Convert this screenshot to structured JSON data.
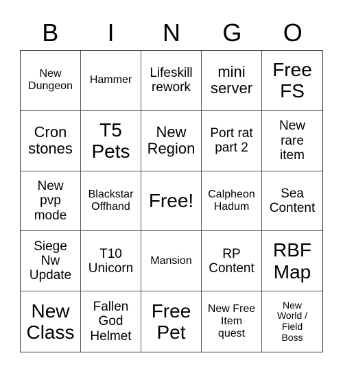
{
  "header": {
    "letters": [
      "B",
      "I",
      "N",
      "G",
      "O"
    ]
  },
  "board": {
    "cells": [
      {
        "text": "New\nDungeon",
        "size": "fs-s"
      },
      {
        "text": "Hammer",
        "size": "fs-s"
      },
      {
        "text": "Lifeskill\nrework",
        "size": "fs-m"
      },
      {
        "text": "mini\nserver",
        "size": "fs-l"
      },
      {
        "text": "Free\nFS",
        "size": "fs-xl"
      },
      {
        "text": "Cron\nstones",
        "size": "fs-l"
      },
      {
        "text": "T5\nPets",
        "size": "fs-xl"
      },
      {
        "text": "New\nRegion",
        "size": "fs-l"
      },
      {
        "text": "Port rat\npart 2",
        "size": "fs-m"
      },
      {
        "text": "New\nrare\nitem",
        "size": "fs-m"
      },
      {
        "text": "New\npvp\nmode",
        "size": "fs-m"
      },
      {
        "text": "Blackstar\nOffhand",
        "size": "fs-s"
      },
      {
        "text": "Free!",
        "size": "fs-xl"
      },
      {
        "text": "Calpheon\nHadum",
        "size": "fs-s"
      },
      {
        "text": "Sea\nContent",
        "size": "fs-m"
      },
      {
        "text": "Siege\nNw\nUpdate",
        "size": "fs-m"
      },
      {
        "text": "T10\nUnicorn",
        "size": "fs-m"
      },
      {
        "text": "Mansion",
        "size": "fs-s"
      },
      {
        "text": "RP\nContent",
        "size": "fs-m"
      },
      {
        "text": "RBF\nMap",
        "size": "fs-xl"
      },
      {
        "text": "New\nClass",
        "size": "fs-xl"
      },
      {
        "text": "Fallen\nGod\nHelmet",
        "size": "fs-m"
      },
      {
        "text": "Free\nPet",
        "size": "fs-xl"
      },
      {
        "text": "New Free\nItem\nquest",
        "size": "fs-s"
      },
      {
        "text": "New\nWorld /\nField\nBoss",
        "size": "fs-xs"
      }
    ]
  }
}
